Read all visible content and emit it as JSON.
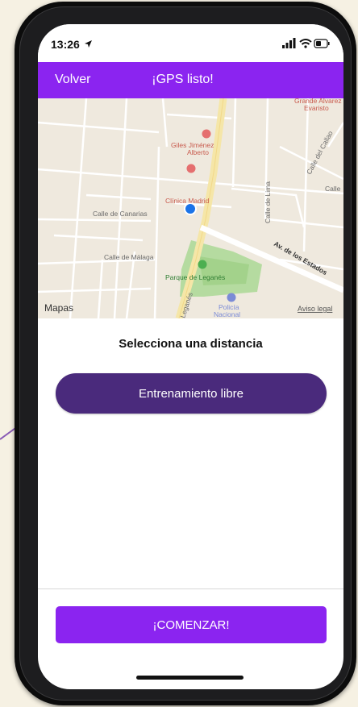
{
  "status_bar": {
    "time": "13:26",
    "icons": [
      "location-arrow-icon",
      "signal-icon",
      "wifi-icon",
      "battery-icon"
    ]
  },
  "header": {
    "back_label": "Volver",
    "title": "¡GPS listo!"
  },
  "map": {
    "labels": {
      "grande_alvarez": "Grande Alvarez",
      "evaristo": "Evaristo",
      "giles_1": "Giles Jiménez",
      "giles_2": "Alberto",
      "clinica": "Clínica Madrid",
      "canarias": "Calle de Canarias",
      "malaga": "Calle de Málaga",
      "lima": "Calle de Lima",
      "callao": "Calle del Callao",
      "calle": "Calle",
      "estados": "Av. de los Estados",
      "parque": "Parque de Leganés",
      "leganes": "Leganés",
      "policia_1": "Policía",
      "policia_2": "Nacional"
    },
    "attribution": "Mapas",
    "legal": "Aviso legal"
  },
  "distance_heading": "Selecciona una distancia",
  "options": [
    "Entrenamiento libre"
  ],
  "start_button": "¡COMENZAR!",
  "colors": {
    "accent": "#8b24f0",
    "option_bg": "#4a2a7c",
    "background": "#f6f1e3",
    "map_park": "#b5dba0"
  }
}
